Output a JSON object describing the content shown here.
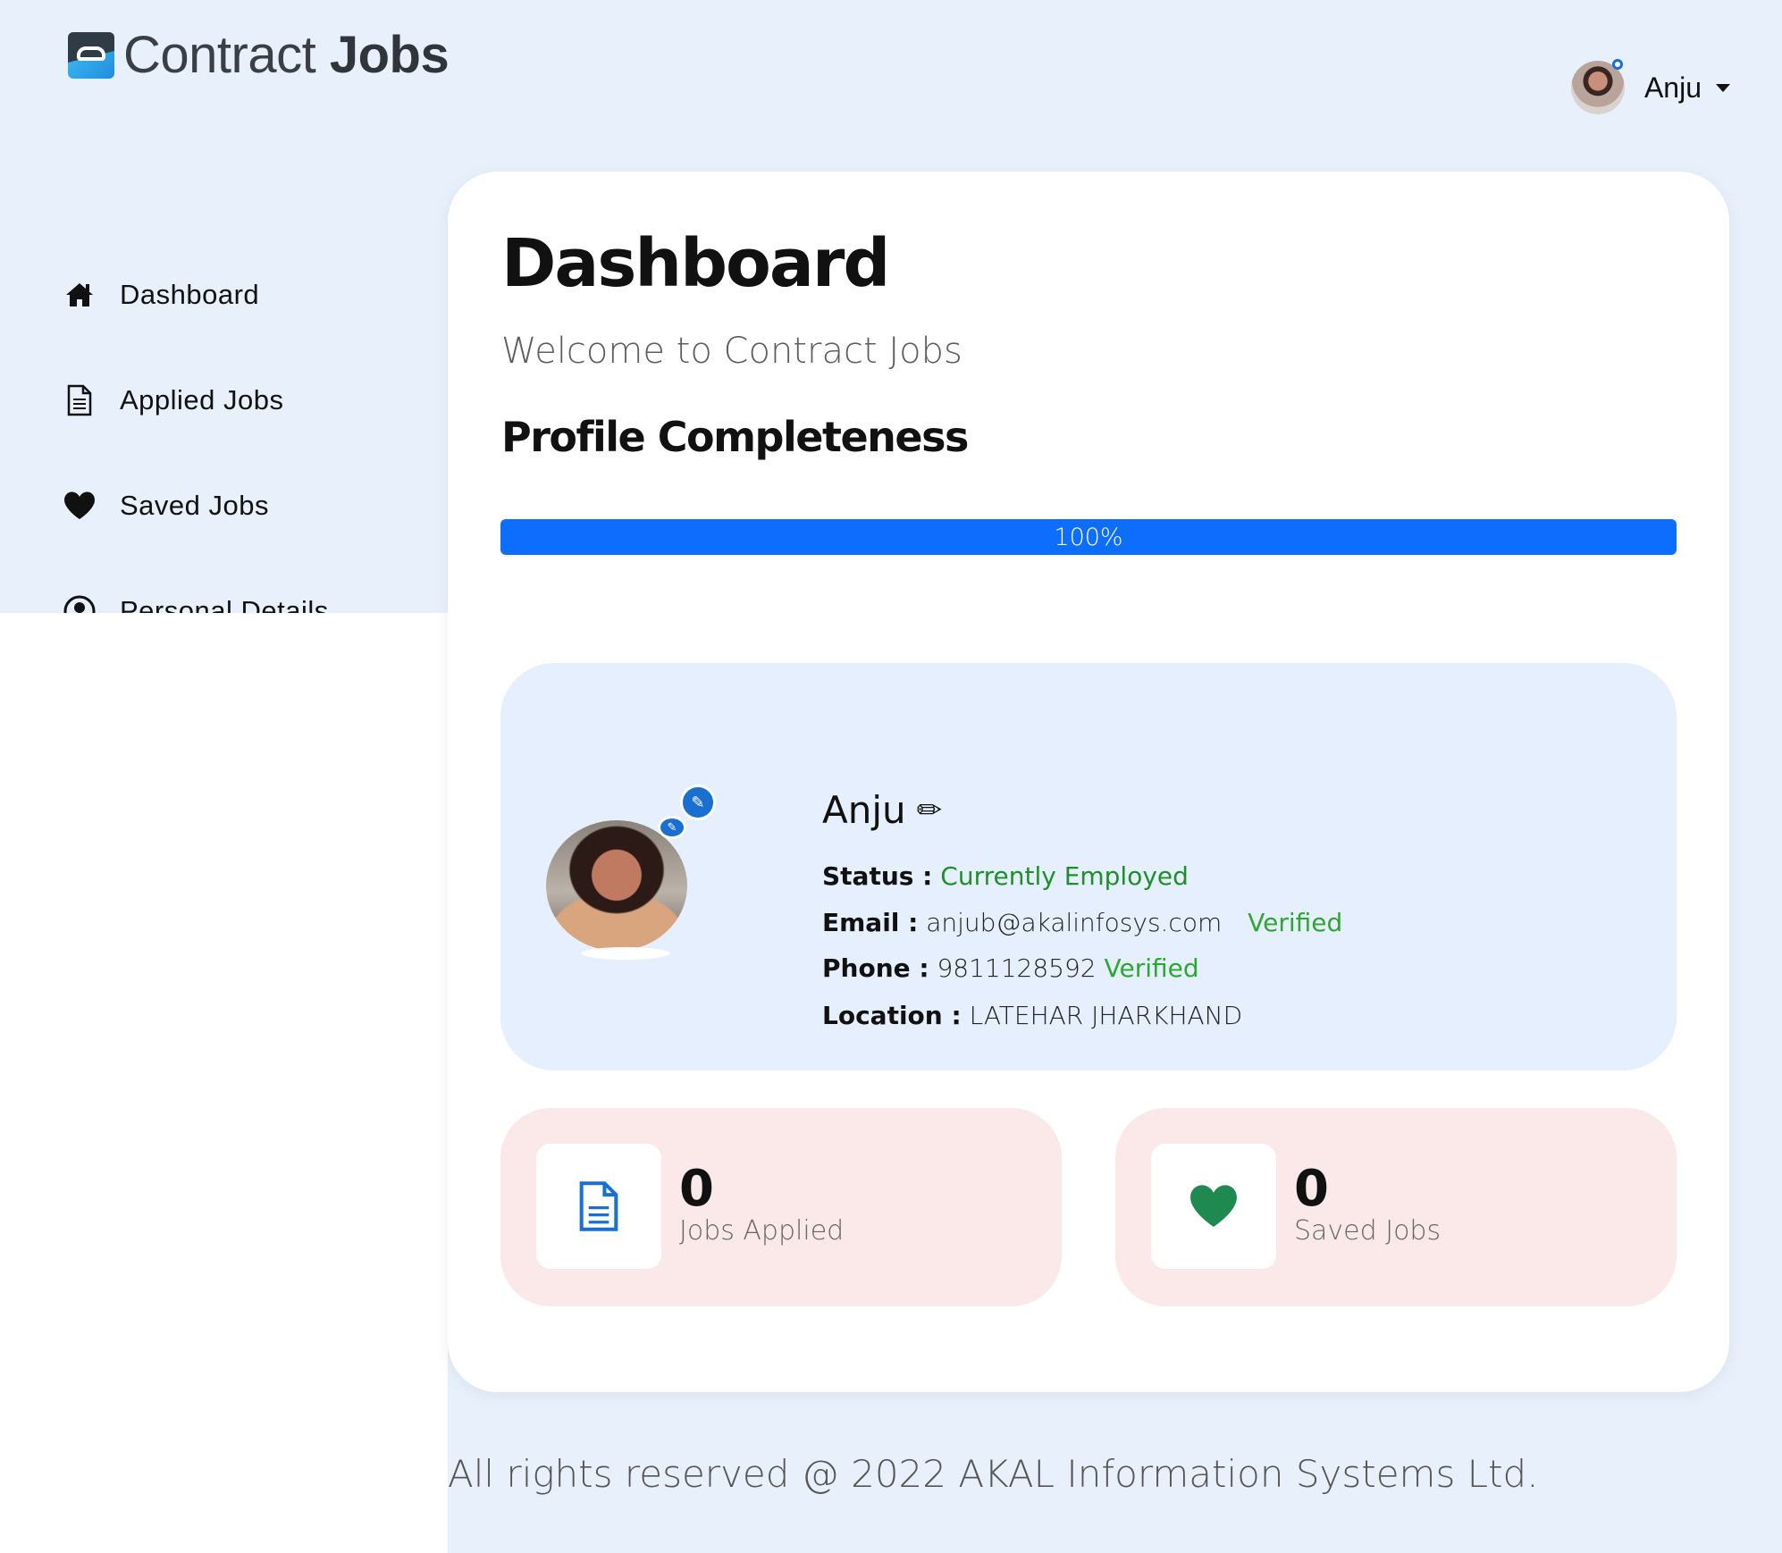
{
  "header": {
    "logo_text_light": "Contract ",
    "logo_text_bold": "Jobs",
    "user_name": "Anju"
  },
  "sidebar": {
    "items": [
      {
        "label": "Dashboard",
        "icon": "home-icon"
      },
      {
        "label": "Applied Jobs",
        "icon": "document-icon"
      },
      {
        "label": "Saved Jobs",
        "icon": "heart-icon"
      },
      {
        "label": "Personal Details",
        "icon": "user-circle-icon"
      }
    ]
  },
  "main": {
    "title": "Dashboard",
    "welcome": "Welcome to Contract Jobs",
    "profile_section_title": "Profile Completeness",
    "progress": {
      "value_percent": 100,
      "label": "100%"
    }
  },
  "profile": {
    "name": "Anju",
    "status_label": "Status :",
    "status_value": "Currently Employed",
    "email_label": "Email :",
    "email_value": "anjub@akalinfosys.com",
    "email_verified": "Verified",
    "phone_label": "Phone :",
    "phone_value": "9811128592",
    "phone_verified": "Verified",
    "location_label": "Location :",
    "location_value": "LATEHAR JHARKHAND"
  },
  "stats": [
    {
      "count": "0",
      "label": "Jobs Applied",
      "icon": "document-icon",
      "icon_color": "#1a6fd1"
    },
    {
      "count": "0",
      "label": "Saved Jobs",
      "icon": "heart-icon",
      "icon_color": "#1e8a4f"
    }
  ],
  "colors": {
    "page_bg": "#e7f0fb",
    "accent": "#0d6efd",
    "verified": "#2fa634",
    "stat_card_bg": "#fbe9ea",
    "profile_card_bg": "#e5effd"
  },
  "footer": {
    "text": "All rights reserved @ 2022 AKAL Information Systems Ltd."
  }
}
